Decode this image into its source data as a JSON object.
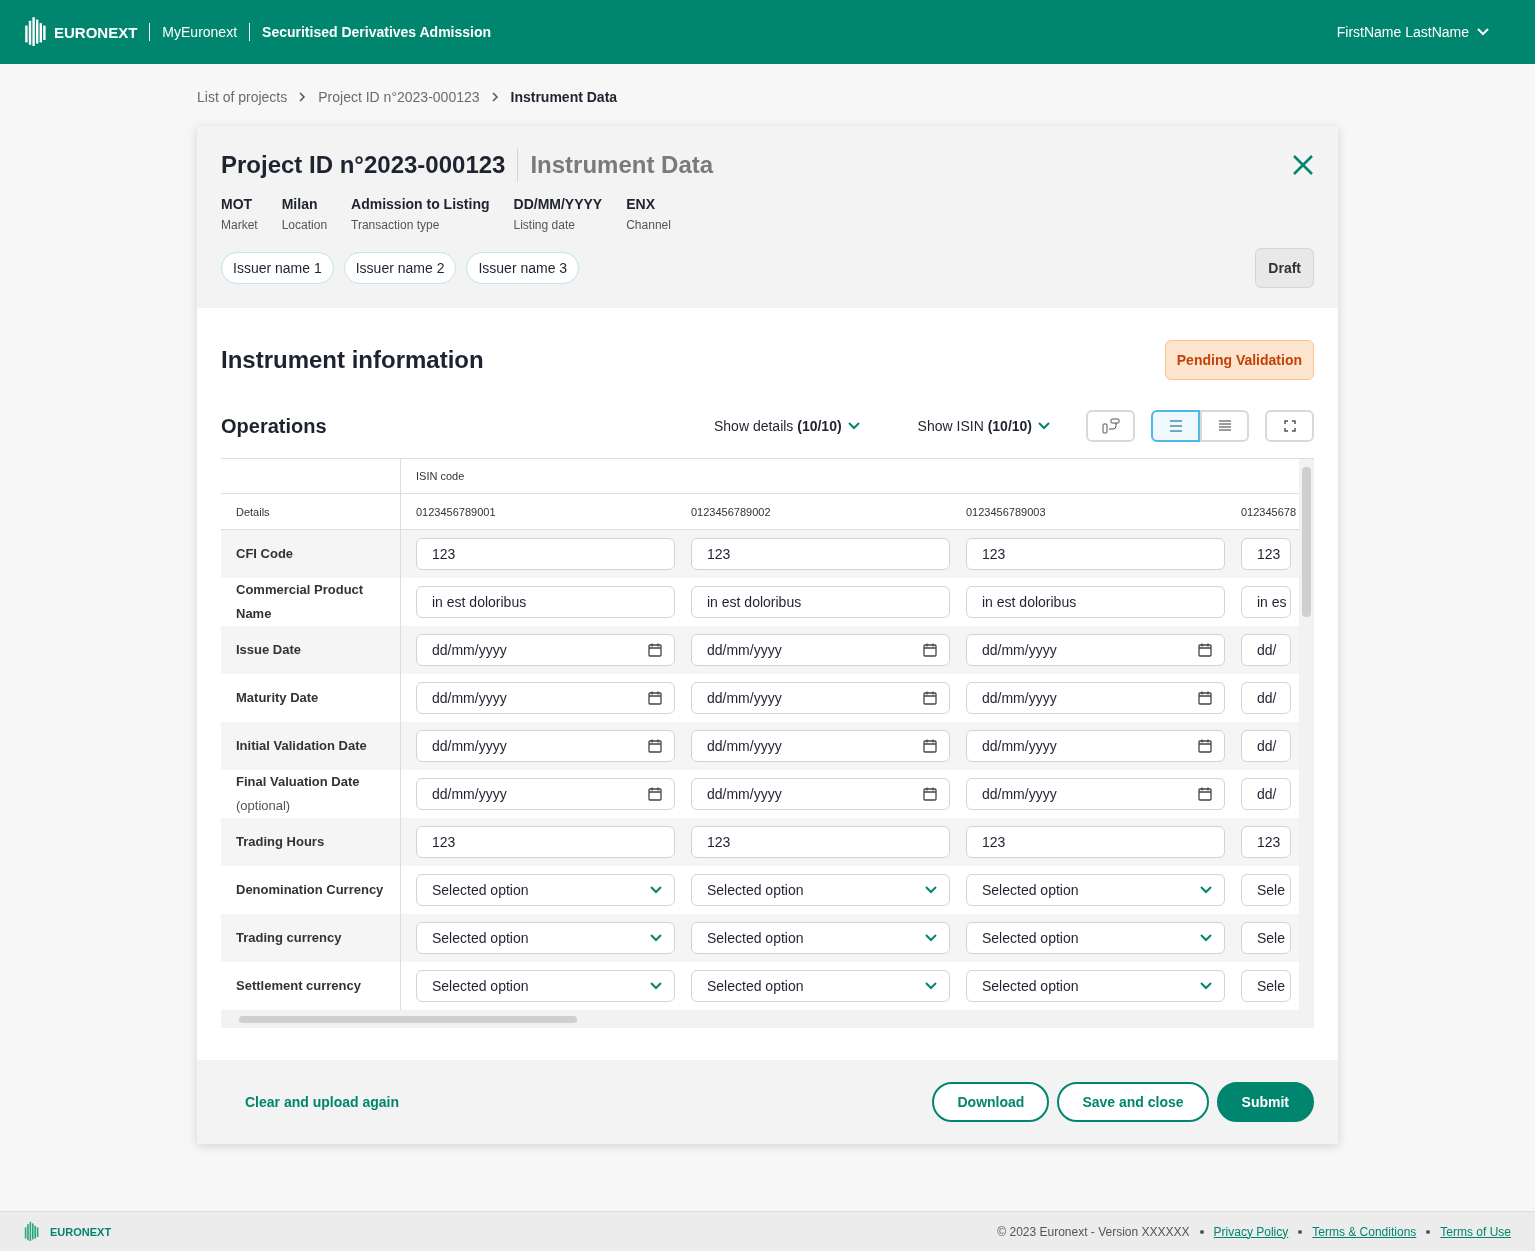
{
  "header": {
    "brand": "EURONEXT",
    "portal": "MyEuronext",
    "app_title": "Securitised Derivatives Admission",
    "user": "FirstName LastName"
  },
  "breadcrumb": [
    {
      "label": "List of projects",
      "current": false
    },
    {
      "label": "Project ID n°2023-000123",
      "current": false
    },
    {
      "label": "Instrument Data",
      "current": true
    }
  ],
  "project": {
    "title": "Project ID n°2023-000123",
    "subtitle": "Instrument Data",
    "facts": [
      {
        "value": "MOT",
        "label": "Market"
      },
      {
        "value": "Milan",
        "label": "Location"
      },
      {
        "value": "Admission to Listing",
        "label": "Transaction type"
      },
      {
        "value": "DD/MM/YYYY",
        "label": "Listing date"
      },
      {
        "value": "ENX",
        "label": "Channel"
      }
    ],
    "issuers": [
      "Issuer name 1",
      "Issuer name 2",
      "Issuer name 3"
    ],
    "status": "Draft"
  },
  "section": {
    "title": "Instrument information",
    "status": "Pending Validation"
  },
  "operations": {
    "title": "Operations",
    "show_details": "Show details **(10/10)**",
    "show_isin": "Show ISIN **(10/10)**",
    "view_toggle": [
      {
        "selected": true
      },
      {
        "selected": false
      }
    ]
  },
  "table": {
    "group_header": "ISIN code",
    "details_header": "Details",
    "isins": [
      "0123456789001",
      "0123456789002",
      "0123456789003",
      "012345678"
    ],
    "rows": [
      {
        "label": "CFI Code",
        "kind": "text",
        "values": [
          "123",
          "123",
          "123",
          "123"
        ]
      },
      {
        "label": "Commercial Product Name",
        "kind": "text",
        "values": [
          "in est doloribus",
          "in est doloribus",
          "in est doloribus",
          "in es"
        ]
      },
      {
        "label": "Issue Date",
        "kind": "date",
        "values": [
          "dd/mm/yyyy",
          "dd/mm/yyyy",
          "dd/mm/yyyy",
          "dd/"
        ]
      },
      {
        "label": "Maturity Date",
        "kind": "date",
        "values": [
          "dd/mm/yyyy",
          "dd/mm/yyyy",
          "dd/mm/yyyy",
          "dd/"
        ]
      },
      {
        "label": "Initial Validation Date",
        "kind": "date",
        "values": [
          "dd/mm/yyyy",
          "dd/mm/yyyy",
          "dd/mm/yyyy",
          "dd/"
        ]
      },
      {
        "label": "Final Valuation Date",
        "note": "(optional)",
        "kind": "date",
        "values": [
          "dd/mm/yyyy",
          "dd/mm/yyyy",
          "dd/mm/yyyy",
          "dd/"
        ]
      },
      {
        "label": "Trading Hours",
        "kind": "text",
        "values": [
          "123",
          "123",
          "123",
          "123"
        ]
      },
      {
        "label": "Denomination Currency",
        "kind": "select",
        "values": [
          "Selected option",
          "Selected option",
          "Selected option",
          "Sele"
        ]
      },
      {
        "label": "Trading currency",
        "kind": "select",
        "values": [
          "Selected option",
          "Selected option",
          "Selected option",
          "Sele"
        ]
      },
      {
        "label": "Settlement currency",
        "kind": "select",
        "values": [
          "Selected option",
          "Selected option",
          "Selected option",
          "Sele"
        ]
      }
    ]
  },
  "actions": {
    "link": "Clear and upload again",
    "buttons": [
      {
        "label": "Download",
        "kind": "outline"
      },
      {
        "label": "Save and close",
        "kind": "outline"
      },
      {
        "label": "Submit",
        "kind": "primary"
      }
    ]
  },
  "footer": {
    "brand": "EURONEXT",
    "copyright": "© 2023 Euronext - Version XXXXXX",
    "links": [
      "Privacy Policy",
      "Terms & Conditions",
      "Terms of Use"
    ]
  }
}
